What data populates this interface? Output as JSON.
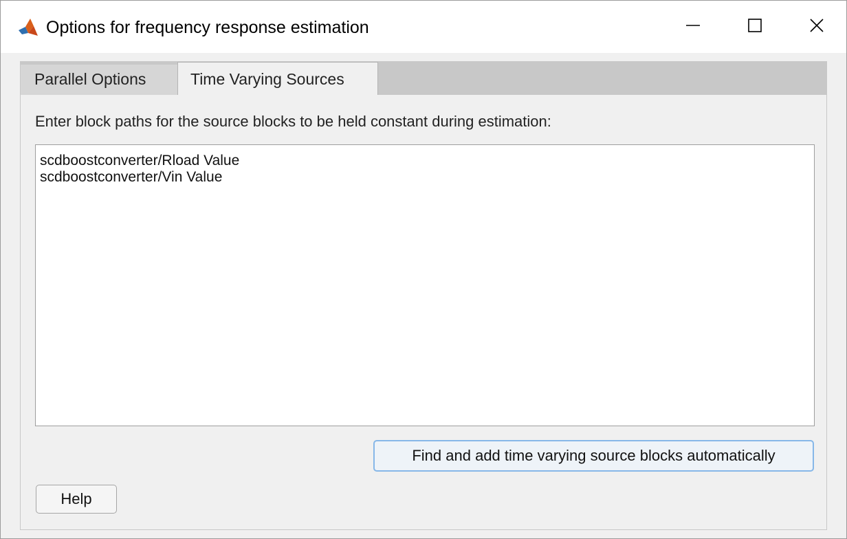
{
  "window": {
    "title": "Options for frequency response estimation",
    "controls": {
      "minimize": "minimize-icon",
      "maximize": "maximize-icon",
      "close": "close-icon"
    }
  },
  "tabs": [
    {
      "label": "Parallel Options",
      "active": false
    },
    {
      "label": "Time Varying Sources",
      "active": true
    }
  ],
  "time_varying_sources": {
    "instruction": "Enter block paths for the source blocks to be held constant during estimation:",
    "block_paths": [
      "scdboostconverter/Rload Value",
      "scdboostconverter/Vin Value"
    ],
    "find_button_label": "Find and add time varying source blocks automatically"
  },
  "footer": {
    "help_label": "Help"
  },
  "colors": {
    "focus_border": "#86b7e8",
    "tab_strip": "#c8c8c8",
    "panel": "#f0f0f0"
  }
}
